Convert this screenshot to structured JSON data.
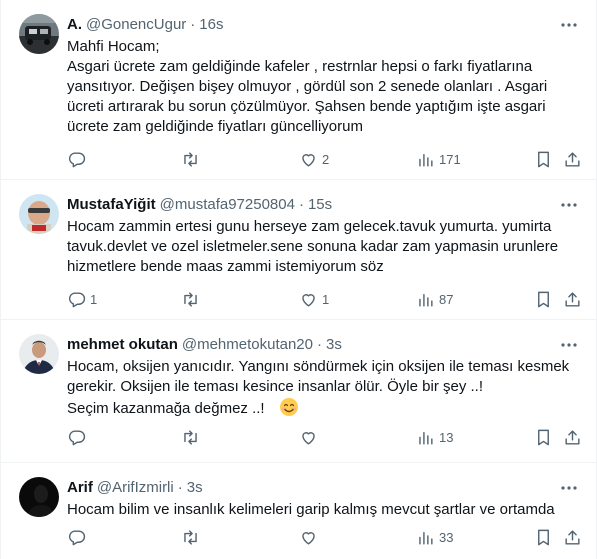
{
  "tweets": [
    {
      "name": "A.",
      "handle": "@GonencUgur",
      "dot": "·",
      "time": "16s",
      "lines": [
        "Mahfi Hocam;",
        "Asgari ücrete zam geldiğinde kafeler , restrnlar hepsi o farkı fiyatlarına",
        "yansıtıyor. Değişen bişey olmuyor , gördül son 2 senede olanları . Asgari",
        "ücreti artırarak bu sorun çözülmüyor. Şahsen bende yaptığım işte asgari",
        "ücrete zam geldiğinde fiyatları güncelliyorum"
      ],
      "reply_count": "",
      "retweet_count": "",
      "like_count": "2",
      "view_count": "171"
    },
    {
      "name": "MustafaYiğit",
      "handle": "@mustafa97250804",
      "dot": "·",
      "time": "15s",
      "lines": [
        "Hocam zammin ertesi gunu herseye zam gelecek.tavuk yumurta. yumirta",
        "tavuk.devlet ve ozel isletmeler.sene sonuna kadar zam yapmasin urunlere",
        "hizmetlere bende maas zammi istemiyorum söz"
      ],
      "reply_count": "1",
      "retweet_count": "",
      "like_count": "1",
      "view_count": "87"
    },
    {
      "name": "mehmet okutan",
      "handle": "@mehmetokutan20",
      "dot": "·",
      "time": "3s",
      "lines": [
        "Hocam, oksijen yanıcıdır. Yangını söndürmek için oksijen ile teması kesmek",
        "gerekir. Oksijen ile teması kesince insanlar ölür. Öyle bir şey ..!",
        "Seçim kazanmağa değmez ..!"
      ],
      "reply_count": "",
      "retweet_count": "",
      "like_count": "",
      "view_count": "13"
    },
    {
      "name": "Arif",
      "handle": "@ArifIzmirli",
      "dot": "·",
      "time": "3s",
      "lines": [
        "Hocam bilim ve insanlık kelimeleri garip kalmış mevcut şartlar ve ortamda"
      ],
      "reply_count": "",
      "retweet_count": "",
      "like_count": "",
      "view_count": "33"
    }
  ],
  "icons": {
    "more": "more-icon",
    "reply": "reply-icon",
    "retweet": "retweet-icon",
    "like": "heart-icon",
    "views": "views-icon",
    "bookmark": "bookmark-icon",
    "share": "share-icon",
    "emoji": "smiling-face-emoji"
  },
  "colors": {
    "text": "#0f1419",
    "secondary": "#536471",
    "divider": "#eff3f4"
  }
}
